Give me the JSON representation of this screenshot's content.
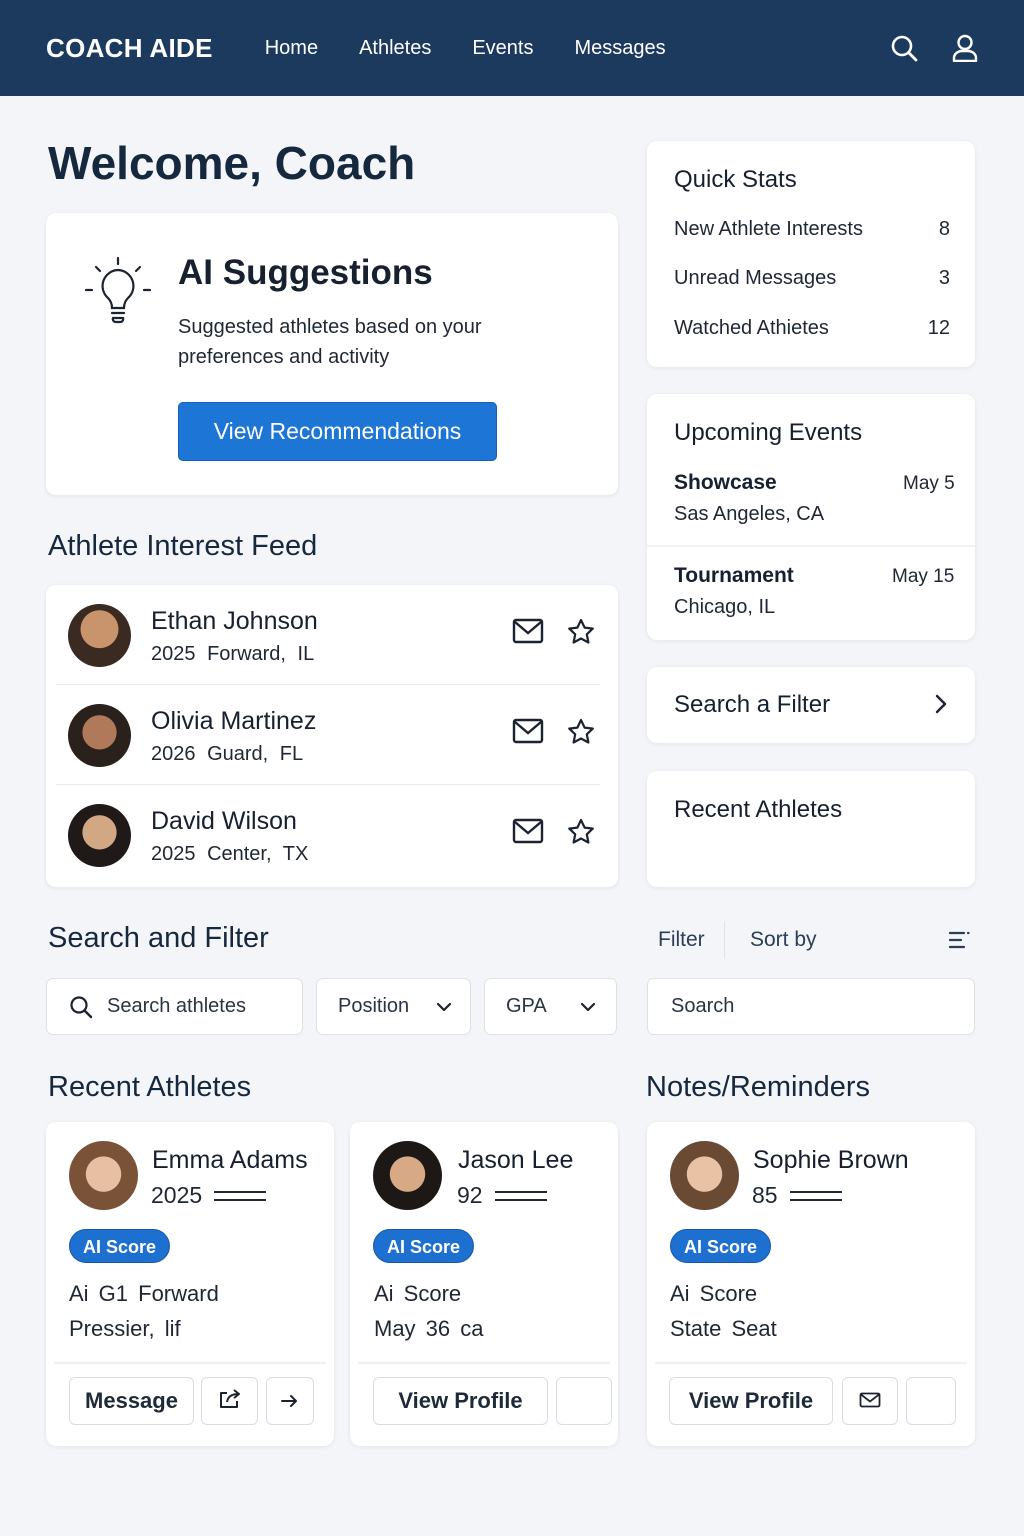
{
  "app": {
    "brand": "COACH AIDE",
    "nav": [
      "Home",
      "Athletes",
      "Events",
      "Messages"
    ]
  },
  "welcome": "Welcome, Coach",
  "ai": {
    "title": "AI Suggestions",
    "description": "Suggested athletes based on your preferences and activity",
    "button": "View Recommendations"
  },
  "feed": {
    "title": "Athlete Interest Feed",
    "items": [
      {
        "name": "Ethan Johnson",
        "year": "2025",
        "detail": "Forward, IL"
      },
      {
        "name": "Olivia Martinez",
        "year": "2026",
        "detail": "Guard, FL"
      },
      {
        "name": "David Wilson",
        "year": "2025",
        "detail": "Center, TX"
      }
    ]
  },
  "quick_stats": {
    "title": "Quick Stats",
    "rows": [
      {
        "label": "New Athlete Interests",
        "value": "8"
      },
      {
        "label": "Unread Messages",
        "value": "3"
      },
      {
        "label": "Watched Athietes",
        "value": "12"
      }
    ]
  },
  "events": {
    "title": "Upcoming Events",
    "items": [
      {
        "name": "Showcase",
        "location": "Sas Angeles, CA",
        "date": "May 5"
      },
      {
        "name": "Tournament",
        "location": "Chicago, IL",
        "date": "May 15"
      }
    ]
  },
  "search_filter_link": "Search a Filter",
  "recent_athletes_panel": "Recent Athletes",
  "search_filter": {
    "title": "Search and Filter",
    "filter_label": "Filter",
    "sort_label": "Sort by",
    "search_placeholder": "Search athletes",
    "position_label": "Position",
    "gpa_label": "GPA",
    "search2_label": "Soarch"
  },
  "recent_athletes": {
    "title": "Recent Athletes",
    "cards": [
      {
        "name": "Emma Adams",
        "sub": "2025",
        "badge": "AI Score",
        "line1": "Ai G1  Forward",
        "line2": "Pressier, lif",
        "button": "Message"
      },
      {
        "name": "Jason Lee",
        "sub": "92",
        "badge": "AI Score",
        "line1": "Ai Score",
        "line2": "May  36  ca",
        "button": "View Profile"
      }
    ]
  },
  "notes": {
    "title": "Notes/Reminders",
    "card": {
      "name": "Sophie Brown",
      "sub": "85",
      "badge": "AI Score",
      "line1": "Ai Score",
      "line2": "State   Seat",
      "button": "View Profile"
    }
  },
  "colors": {
    "header": "#1c3a5e",
    "primary": "#1d75d6",
    "badge": "#1d6fd0",
    "background": "#f3f5f9"
  },
  "icons": [
    "search-icon",
    "user-icon",
    "lightbulb-icon",
    "mail-icon",
    "star-icon",
    "chevron-right-icon",
    "chevron-down-icon",
    "menu-lines-icon",
    "share-icon",
    "arrow-right-icon"
  ]
}
